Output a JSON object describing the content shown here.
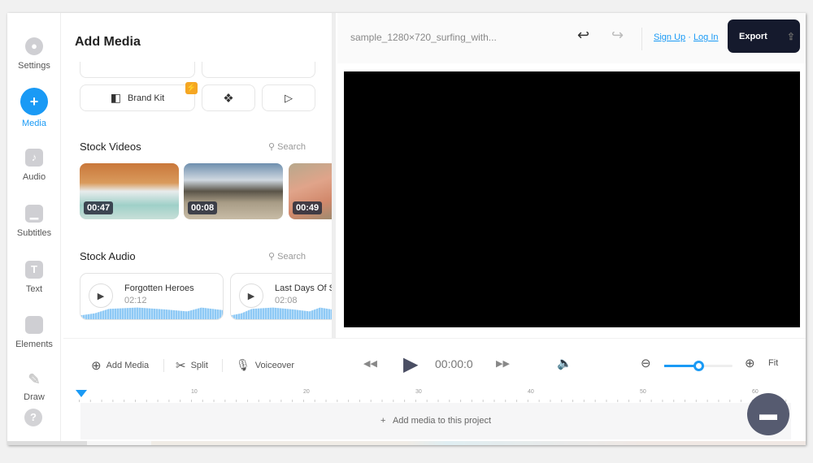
{
  "sidebar": {
    "items": [
      {
        "label": "Settings"
      },
      {
        "label": "Media"
      },
      {
        "label": "Audio"
      },
      {
        "label": "Subtitles"
      },
      {
        "label": "Text"
      },
      {
        "label": "Elements"
      },
      {
        "label": "Draw"
      }
    ],
    "active": "Media",
    "accent": "#1a9af5"
  },
  "panel": {
    "title": "Add Media",
    "brand_kit": "Brand Kit",
    "stock_videos": {
      "title": "Stock Videos",
      "search": "Search",
      "items": [
        {
          "duration": "00:47"
        },
        {
          "duration": "00:08"
        },
        {
          "duration": "00:49"
        }
      ]
    },
    "stock_audio": {
      "title": "Stock Audio",
      "search": "Search",
      "items": [
        {
          "title": "Forgotten Heroes",
          "duration": "02:12"
        },
        {
          "title": "Last Days Of S",
          "duration": "02:08"
        }
      ]
    }
  },
  "header": {
    "filename": "sample_1280×720_surfing_with...",
    "sign_up": "Sign Up",
    "separator": "·",
    "log_in": "Log In",
    "export": "Export"
  },
  "toolbar": {
    "add_media": "Add Media",
    "split": "Split",
    "voiceover": "Voiceover",
    "time": "00:00:0",
    "fit": "Fit",
    "zoom_level": 0.5
  },
  "timeline": {
    "ticks": [
      "10",
      "20",
      "30",
      "40",
      "50",
      "60"
    ],
    "empty": "Add media to this project",
    "add": "+"
  }
}
